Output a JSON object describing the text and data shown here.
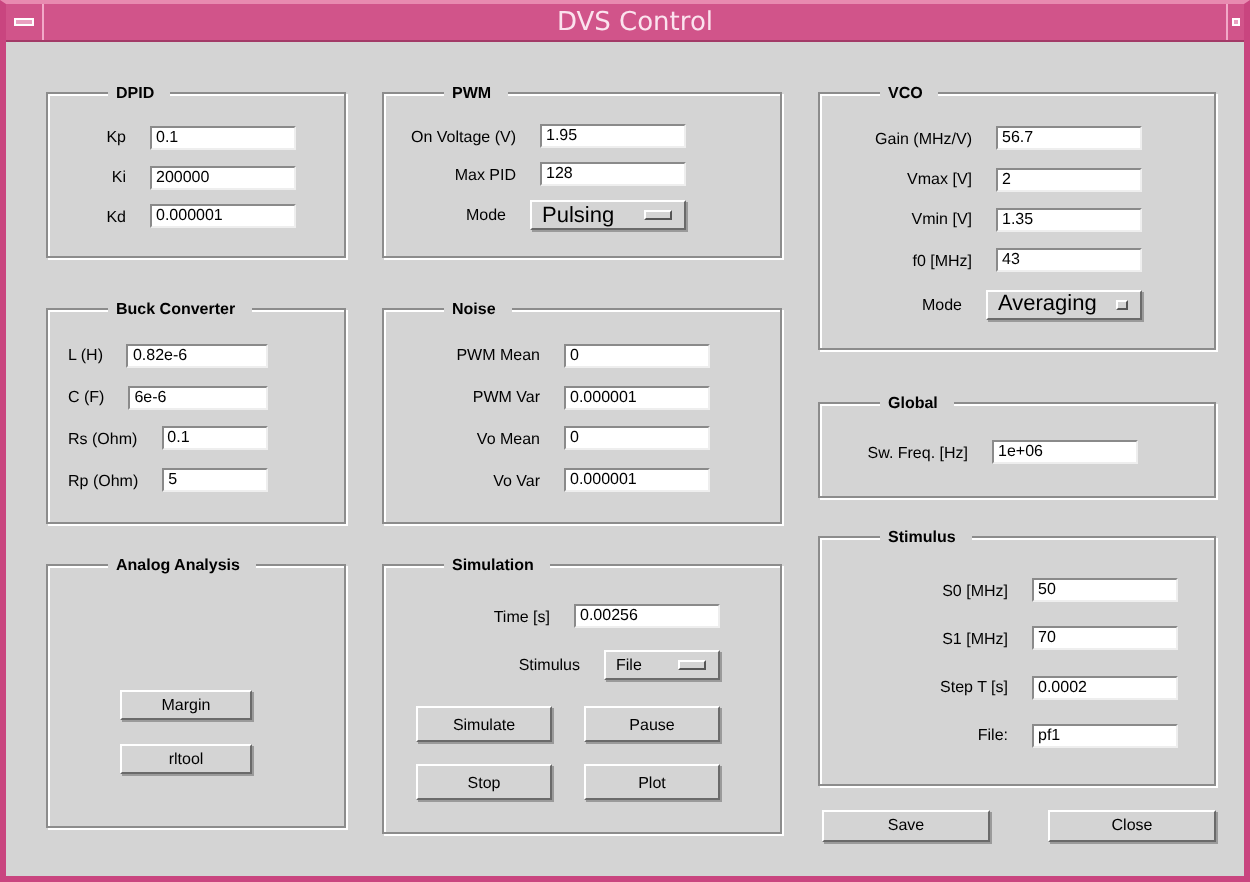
{
  "window": {
    "title": "DVS Control"
  },
  "columns": [
    [
      {
        "title": "DPID",
        "rows": [
          {
            "kind": "field",
            "label": "Kp",
            "value": "0.1"
          },
          {
            "kind": "field",
            "label": "Ki",
            "value": "200000"
          },
          {
            "kind": "field",
            "label": "Kd",
            "value": "0.000001"
          }
        ]
      },
      {
        "title": "Buck Converter",
        "rows": [
          {
            "kind": "field",
            "label": "L (H)",
            "value": "0.82e-6"
          },
          {
            "kind": "field",
            "label": "C (F)",
            "value": "6e-6"
          },
          {
            "kind": "field",
            "label": "Rs (Ohm)",
            "value": "0.1"
          },
          {
            "kind": "field",
            "label": "Rp (Ohm)",
            "value": "5"
          }
        ]
      },
      {
        "title": "Analog Analysis",
        "rows": [
          {
            "kind": "button",
            "label": "Margin"
          },
          {
            "kind": "button",
            "label": "rltool"
          }
        ]
      }
    ],
    [
      {
        "title": "PWM",
        "rows": [
          {
            "kind": "field",
            "label": "On Voltage (V)",
            "value": "1.95"
          },
          {
            "kind": "field",
            "label": "Max PID",
            "value": "128"
          },
          {
            "kind": "menu",
            "label": "Mode",
            "value": "Pulsing"
          }
        ]
      },
      {
        "title": "Noise",
        "rows": [
          {
            "kind": "field",
            "label": "PWM Mean",
            "value": "0"
          },
          {
            "kind": "field",
            "label": "PWM Var",
            "value": "0.000001"
          },
          {
            "kind": "field",
            "label": "Vo Mean",
            "value": "0"
          },
          {
            "kind": "field",
            "label": "Vo Var",
            "value": "0.000001"
          }
        ]
      },
      {
        "title": "Simulation",
        "rows": [
          {
            "kind": "field",
            "label": "Time [s]",
            "value": "0.00256"
          },
          {
            "kind": "menu",
            "label": "Stimulus",
            "value": "File"
          },
          {
            "kind": "button_pair",
            "buttons": [
              "Simulate",
              "Pause"
            ]
          },
          {
            "kind": "button_pair",
            "buttons": [
              "Stop",
              "Plot"
            ]
          }
        ]
      }
    ],
    [
      {
        "title": "VCO",
        "rows": [
          {
            "kind": "field",
            "label": "Gain (MHz/V)",
            "value": "56.7"
          },
          {
            "kind": "field",
            "label": "Vmax [V]",
            "value": "2"
          },
          {
            "kind": "field",
            "label": "Vmin [V]",
            "value": "1.35"
          },
          {
            "kind": "field",
            "label": "f0 [MHz]",
            "value": "43"
          },
          {
            "kind": "menu",
            "label": "Mode",
            "value": "Averaging"
          }
        ]
      },
      {
        "title": "Global",
        "rows": [
          {
            "kind": "field",
            "label": "Sw. Freq. [Hz]",
            "value": "1e+06"
          }
        ]
      },
      {
        "title": "Stimulus",
        "rows": [
          {
            "kind": "field",
            "label": "S0 [MHz]",
            "value": "50"
          },
          {
            "kind": "field",
            "label": "S1 [MHz]",
            "value": "70"
          },
          {
            "kind": "field",
            "label": "Step T [s]",
            "value": "0.0002"
          },
          {
            "kind": "field",
            "label": "File:",
            "value": "pf1"
          }
        ]
      }
    ]
  ],
  "footer_buttons": [
    "Save",
    "Close"
  ]
}
